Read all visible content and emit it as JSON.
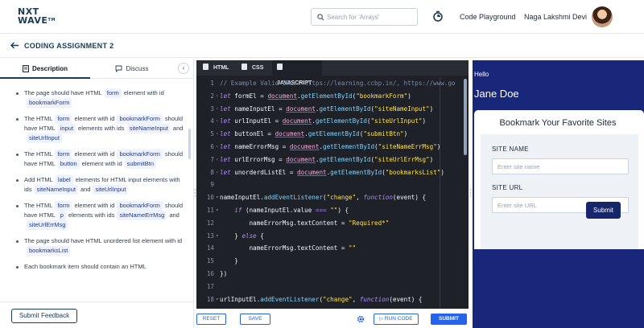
{
  "topbar": {
    "logo_line1": "NXT",
    "logo_line2": "WAVE",
    "logo_tm": "TM",
    "search_placeholder": "Search for 'Arrays'",
    "nav_link": "Code Playground",
    "user_name": "Naga Lakshmi Devi"
  },
  "header": {
    "title": "CODING ASSIGNMENT 2"
  },
  "left_panel": {
    "tabs": [
      {
        "label": "Description"
      },
      {
        "label": "Discuss"
      }
    ],
    "collapse_label": "‹",
    "feedback_label": "Submit Feedback",
    "items": [
      {
        "parts": [
          [
            "t",
            "The page should have HTML"
          ],
          [
            "c",
            "form"
          ],
          [
            "t",
            "element with id"
          ],
          [
            "c",
            "bookmarkForm"
          ]
        ]
      },
      {
        "parts": [
          [
            "t",
            "The HTML"
          ],
          [
            "c",
            "form"
          ],
          [
            "t",
            "element with id"
          ],
          [
            "c",
            "bookmarkForm"
          ],
          [
            "t",
            "should have HTML"
          ],
          [
            "c",
            "input"
          ],
          [
            "t",
            "elements with ids"
          ],
          [
            "c",
            "siteNameInput"
          ],
          [
            "t",
            "and"
          ],
          [
            "c",
            "siteUrlInput"
          ]
        ]
      },
      {
        "parts": [
          [
            "t",
            "The HTML"
          ],
          [
            "c",
            "form"
          ],
          [
            "t",
            "element with id"
          ],
          [
            "c",
            "bookmarkForm"
          ],
          [
            "t",
            "should have HTML"
          ],
          [
            "c",
            "button"
          ],
          [
            "t",
            "element with id"
          ],
          [
            "c",
            "submitBtn"
          ]
        ]
      },
      {
        "parts": [
          [
            "t",
            "Add HTML"
          ],
          [
            "c",
            "label"
          ],
          [
            "t",
            "elements for HTML input elements with ids"
          ],
          [
            "c",
            "siteNameInput"
          ],
          [
            "t",
            "and"
          ],
          [
            "c",
            "siteUrlInput"
          ]
        ]
      },
      {
        "parts": [
          [
            "t",
            "The HTML"
          ],
          [
            "c",
            "form"
          ],
          [
            "t",
            "element with id"
          ],
          [
            "c",
            "bookmarkForm"
          ],
          [
            "t",
            "should have HTML"
          ],
          [
            "c",
            "p"
          ],
          [
            "t",
            "elements with ids"
          ],
          [
            "c",
            "siteNameErrMsg"
          ],
          [
            "t",
            "and"
          ],
          [
            "c",
            "siteUrlErrMsg"
          ]
        ]
      },
      {
        "parts": [
          [
            "t",
            "The page should have HTML unordered list element with id"
          ],
          [
            "c",
            "bookmarksList"
          ]
        ]
      },
      {
        "parts": [
          [
            "t",
            "Each bookmark item should contain an HTML"
          ]
        ]
      }
    ]
  },
  "editor": {
    "tabs": [
      {
        "label": "HTML"
      },
      {
        "label": "CSS"
      },
      {
        "label": "JAVASCRIPT"
      }
    ],
    "lines": [
      {
        "n": "1",
        "fold": "",
        "segs": [
          [
            "comment",
            "// Example Valid URLs: https://learning.ccbp.in/, https://www.go"
          ]
        ]
      },
      {
        "n": "2",
        "fold": "‹",
        "segs": [
          [
            "kw",
            "let"
          ],
          [
            "plain",
            " formEl = "
          ],
          [
            "doc",
            "document"
          ],
          [
            "plain",
            "."
          ],
          [
            "fn",
            "getElementById"
          ],
          [
            "plain",
            "("
          ],
          [
            "str",
            "\"bookmarkForm\""
          ],
          [
            "plain",
            ")"
          ]
        ]
      },
      {
        "n": "3",
        "fold": "‹",
        "segs": [
          [
            "kw",
            "let"
          ],
          [
            "plain",
            " nameInputEl = "
          ],
          [
            "doc",
            "document"
          ],
          [
            "plain",
            "."
          ],
          [
            "fn",
            "getElementById"
          ],
          [
            "plain",
            "("
          ],
          [
            "str",
            "\"siteNameInput\""
          ],
          [
            "plain",
            ")"
          ]
        ]
      },
      {
        "n": "4",
        "fold": "‹",
        "segs": [
          [
            "kw",
            "let"
          ],
          [
            "plain",
            " urlInputEl = "
          ],
          [
            "doc",
            "document"
          ],
          [
            "plain",
            "."
          ],
          [
            "fn",
            "getElementById"
          ],
          [
            "plain",
            "("
          ],
          [
            "str",
            "\"siteUrlInput\""
          ],
          [
            "plain",
            ")"
          ]
        ]
      },
      {
        "n": "5",
        "fold": "‹",
        "segs": [
          [
            "kw",
            "let"
          ],
          [
            "plain",
            " buttonEl = "
          ],
          [
            "doc",
            "document"
          ],
          [
            "plain",
            "."
          ],
          [
            "fn",
            "getElementById"
          ],
          [
            "plain",
            "("
          ],
          [
            "str",
            "\"submitBtn\""
          ],
          [
            "plain",
            ")"
          ]
        ]
      },
      {
        "n": "6",
        "fold": "‹",
        "segs": [
          [
            "kw",
            "let"
          ],
          [
            "plain",
            " nameErrorMsg = "
          ],
          [
            "doc",
            "document"
          ],
          [
            "plain",
            "."
          ],
          [
            "fn",
            "getElementById"
          ],
          [
            "plain",
            "("
          ],
          [
            "str",
            "\"siteNameErrMsg\""
          ],
          [
            "plain",
            ")"
          ]
        ]
      },
      {
        "n": "7",
        "fold": "‹",
        "segs": [
          [
            "kw",
            "let"
          ],
          [
            "plain",
            " urlErrorMsg = "
          ],
          [
            "doc",
            "document"
          ],
          [
            "plain",
            "."
          ],
          [
            "fn",
            "getElementById"
          ],
          [
            "plain",
            "("
          ],
          [
            "str",
            "\"siteUrlErrMsg\""
          ],
          [
            "plain",
            ")"
          ]
        ]
      },
      {
        "n": "8",
        "fold": "‹",
        "segs": [
          [
            "kw",
            "let"
          ],
          [
            "plain",
            " unorderdListEl = "
          ],
          [
            "doc",
            "document"
          ],
          [
            "plain",
            "."
          ],
          [
            "fn",
            "getElementById"
          ],
          [
            "plain",
            "("
          ],
          [
            "str",
            "\"bookmarksList\""
          ],
          [
            "plain",
            ")"
          ]
        ]
      },
      {
        "n": "9",
        "fold": "",
        "segs": []
      },
      {
        "n": "10",
        "fold": "▾",
        "segs": [
          [
            "plain",
            "nameInputEl."
          ],
          [
            "fn",
            "addEventListener"
          ],
          [
            "plain",
            "("
          ],
          [
            "str",
            "\"change\""
          ],
          [
            "plain",
            ", "
          ],
          [
            "kw",
            "function"
          ],
          [
            "plain",
            "(event) {"
          ]
        ]
      },
      {
        "n": "11",
        "fold": "▾",
        "segs": [
          [
            "plain",
            "    "
          ],
          [
            "kw",
            "if"
          ],
          [
            "plain",
            " (nameInputEl.value "
          ],
          [
            "kw",
            "==="
          ],
          [
            "plain",
            " "
          ],
          [
            "str",
            "\"\""
          ],
          [
            "plain",
            ") {"
          ]
        ]
      },
      {
        "n": "12",
        "fold": "",
        "segs": [
          [
            "plain",
            "        nameErrorMsg.textContent = "
          ],
          [
            "str",
            "\"Required*\""
          ]
        ]
      },
      {
        "n": "13",
        "fold": "▾",
        "segs": [
          [
            "plain",
            "    } "
          ],
          [
            "kw",
            "else"
          ],
          [
            "plain",
            " {"
          ]
        ]
      },
      {
        "n": "14",
        "fold": "",
        "segs": [
          [
            "plain",
            "        nameErrorMsg.textContent = "
          ],
          [
            "str",
            "\"\""
          ]
        ]
      },
      {
        "n": "15",
        "fold": "",
        "segs": [
          [
            "plain",
            "    }"
          ]
        ]
      },
      {
        "n": "16",
        "fold": "",
        "segs": [
          [
            "plain",
            "})"
          ]
        ]
      },
      {
        "n": "17",
        "fold": "",
        "segs": []
      },
      {
        "n": "18",
        "fold": "▾",
        "segs": [
          [
            "plain",
            "urlInputEl."
          ],
          [
            "fn",
            "addEventListener"
          ],
          [
            "plain",
            "("
          ],
          [
            "str",
            "\"change\""
          ],
          [
            "plain",
            ", "
          ],
          [
            "kw",
            "function"
          ],
          [
            "plain",
            "(event) {"
          ]
        ]
      }
    ]
  },
  "toolbar": {
    "reset_label": "RESET",
    "save_label": "SAVE",
    "run_label": "RUN CODE",
    "submit_label": "SUBMIT"
  },
  "preview": {
    "hello": "Hello",
    "name": "Jane Doe",
    "card_title": "Bookmark Your Favorite Sites",
    "site_name_label": "SITE NAME",
    "site_name_placeholder": "Enter site name",
    "site_url_label": "SITE URL",
    "site_url_placeholder": "Enter site URL",
    "submit_label": "Submit"
  },
  "colors": {
    "brand": "#183b56",
    "accent": "#2563eb",
    "preview_bg": "#19277a",
    "editor_bg": "#1f2128"
  }
}
